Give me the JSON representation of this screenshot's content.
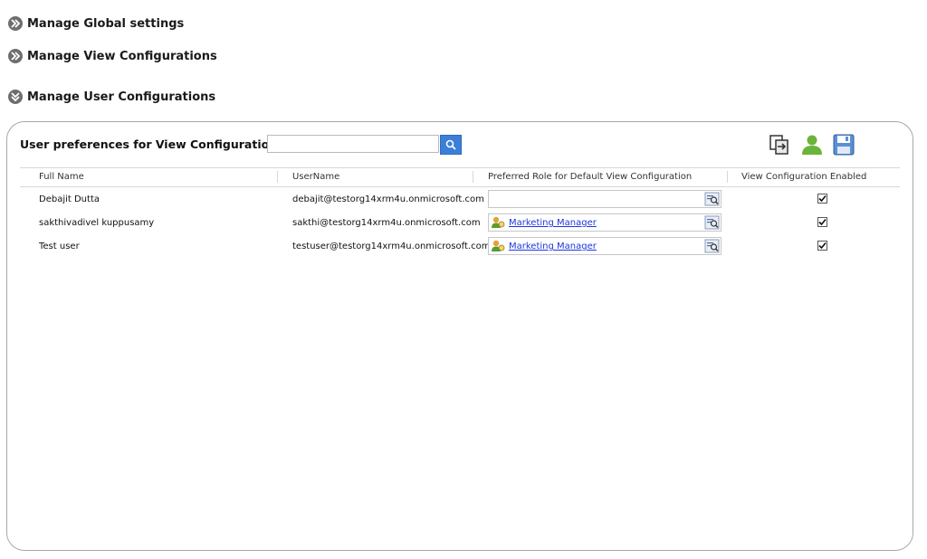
{
  "sections": {
    "global": "Manage Global settings",
    "view": "Manage View Configurations",
    "user": "Manage User Configurations"
  },
  "panel": {
    "title": "User preferences for View Configuration",
    "search": {
      "value": "",
      "placeholder": ""
    }
  },
  "grid": {
    "headers": [
      "Full Name",
      "UserName",
      "Preferred Role for Default View Configuration",
      "View Configuration Enabled"
    ],
    "rows": [
      {
        "full_name": "Debajit Dutta",
        "username": "debajit@testorg14xrm4u.onmicrosoft.com",
        "role": "",
        "enabled": true
      },
      {
        "full_name": "sakthivadivel kuppusamy",
        "username": "sakthi@testorg14xrm4u.onmicrosoft.com",
        "role": "Marketing Manager",
        "enabled": true
      },
      {
        "full_name": "Test user",
        "username": "testuser@testorg14xrm4u.onmicrosoft.com",
        "role": "Marketing Manager",
        "enabled": true
      }
    ]
  },
  "icons": {
    "section_collapsed": "double-chevron-right-icon",
    "section_expanded": "double-chevron-down-icon",
    "search": "search-icon",
    "copy": "copy-settings-icon",
    "user": "user-icon",
    "save": "save-icon",
    "role": "security-role-icon",
    "lookup": "lookup-icon"
  },
  "colors": {
    "search_button": "#3b7fd9",
    "link": "#1d35e0",
    "user_icon": "#6bb43a",
    "save_icon": "#5a8fd6"
  }
}
